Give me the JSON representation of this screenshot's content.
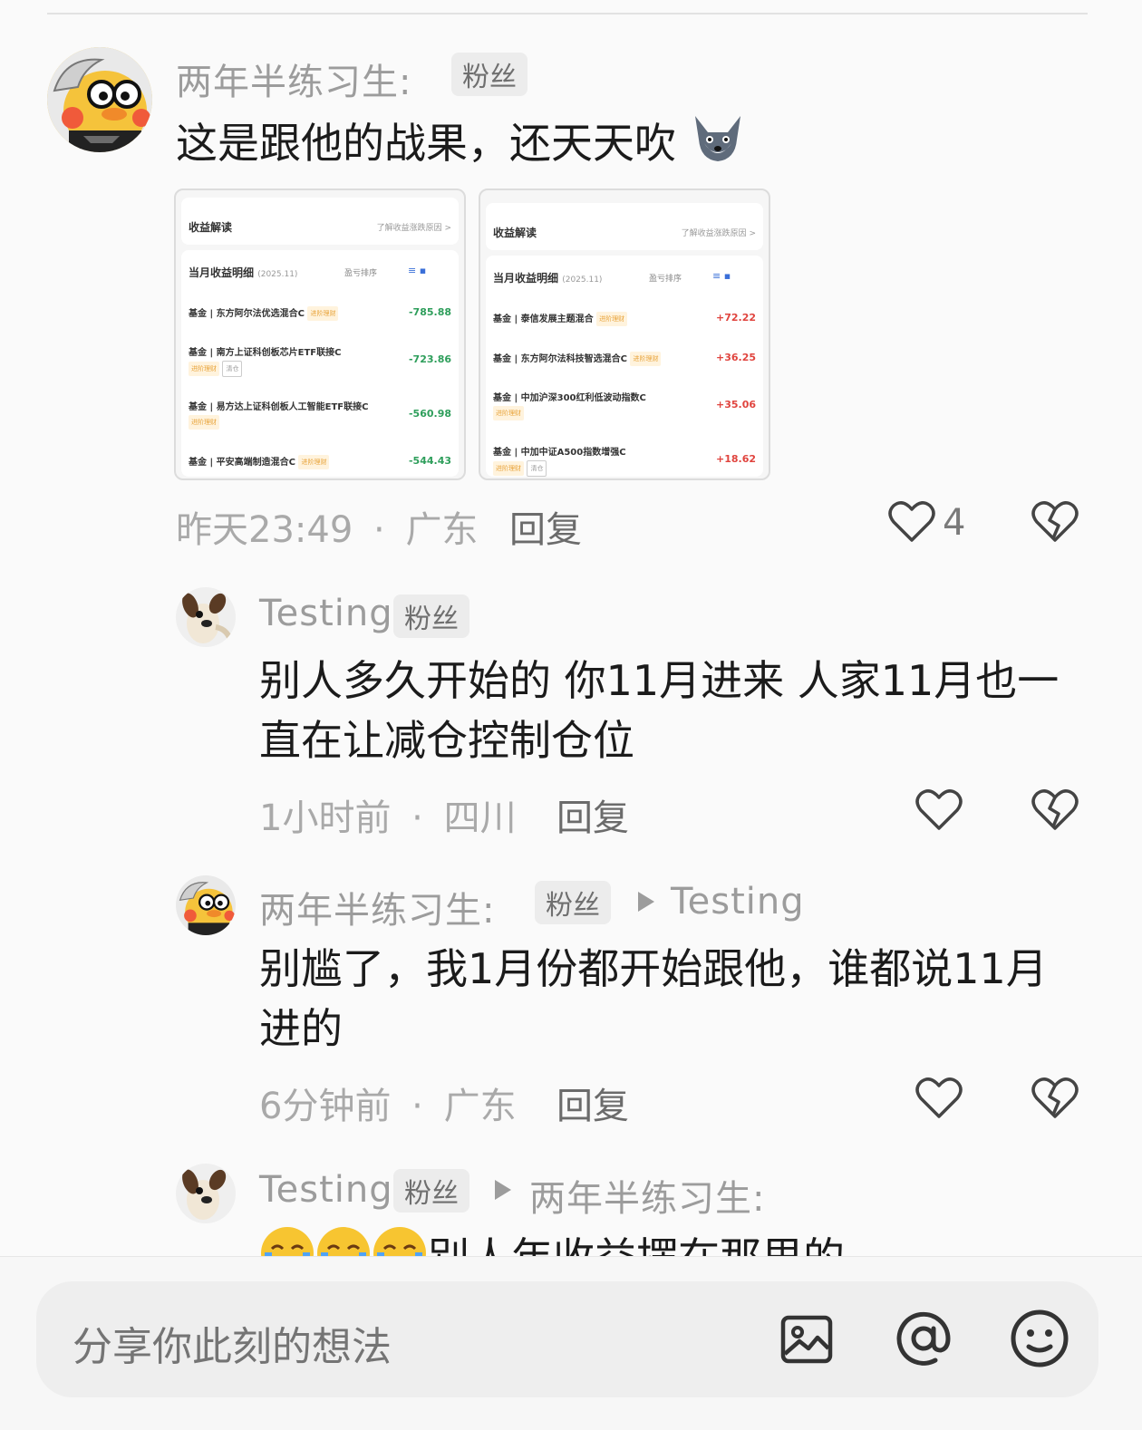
{
  "comments": [
    {
      "author": "两年半练习生:",
      "badge": "粉丝",
      "text": "这是跟他的战果，还天天吹",
      "time": "昨天23:49",
      "location": "广东",
      "reply_label": "回复",
      "likes": "4",
      "screenshots": [
        {
          "title": "收益解读",
          "title_link": "了解收益涨跌原因 >",
          "sub": "当月收益明细",
          "sub_date": "(2025.11)",
          "sort": "盈亏排序",
          "rows": [
            {
              "name": "基金 | 东方阿尔法优选混合C",
              "tag": "进阶理财",
              "value": "-785.88"
            },
            {
              "name": "基金 | 南方上证科创板芯片ETF联接C",
              "tag": "进阶理财",
              "tag2": "清仓",
              "value": "-723.86"
            },
            {
              "name": "基金 | 易方达上证科创板人工智能ETF联接C",
              "tag": "进阶理财",
              "value": "-560.98"
            },
            {
              "name": "基金 | 平安高端制造混合C",
              "tag": "进阶理财",
              "value": "-544.43"
            }
          ]
        },
        {
          "title": "收益解读",
          "title_link": "了解收益涨跌原因 >",
          "sub": "当月收益明细",
          "sub_date": "(2025.11)",
          "sort": "盈亏排序",
          "rows": [
            {
              "name": "基金 | 泰信发展主题混合",
              "tag": "进阶理财",
              "value": "+72.22"
            },
            {
              "name": "基金 | 东方阿尔法科技智选混合C",
              "tag": "进阶理财",
              "value": "+36.25"
            },
            {
              "name": "基金 | 中加沪深300红利低波动指数C",
              "tag": "进阶理财",
              "value": "+35.06"
            },
            {
              "name": "基金 | 中加中证A500指数增强C",
              "tag": "进阶理财",
              "tag2": "清仓",
              "value": "+18.62"
            }
          ]
        }
      ]
    },
    {
      "author": "Testing",
      "badge": "粉丝",
      "text": "别人多久开始的 你11月进来 人家11月也一直在让减仓控制仓位",
      "time": "1小时前",
      "location": "四川",
      "reply_label": "回复"
    },
    {
      "author": "两年半练习生:",
      "badge": "粉丝",
      "reply_to": "Testing",
      "text": "别尴了，我1月份都开始跟他，谁都说11月进的",
      "time": "6分钟前",
      "location": "广东",
      "reply_label": "回复"
    },
    {
      "author": "Testing",
      "badge": "粉丝",
      "reply_to": "两年半练习生:",
      "text": "别人年收益摆在那里的"
    }
  ],
  "meta_separator": "·",
  "composer": {
    "placeholder": "分享你此刻的想法"
  },
  "icons": [
    "heart-outline-icon",
    "broken-heart-icon",
    "image-icon",
    "at-icon",
    "emoji-icon",
    "wolf-emoji-icon",
    "crying-emoji-icon"
  ]
}
